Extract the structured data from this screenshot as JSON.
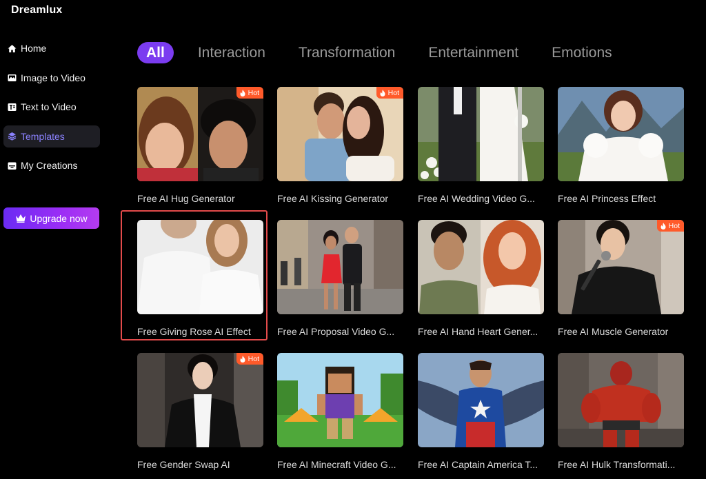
{
  "app": {
    "name": "Dreamlux"
  },
  "sidebar": {
    "items": [
      {
        "label": "Home",
        "icon": "home-icon"
      },
      {
        "label": "Image to Video",
        "icon": "image-icon"
      },
      {
        "label": "Text to Video",
        "icon": "text-icon"
      },
      {
        "label": "Templates",
        "icon": "layers-icon",
        "active": true
      },
      {
        "label": "My Creations",
        "icon": "folder-icon"
      }
    ],
    "upgrade_label": "Upgrade now"
  },
  "tabs": [
    {
      "label": "All",
      "active": true
    },
    {
      "label": "Interaction"
    },
    {
      "label": "Transformation"
    },
    {
      "label": "Entertainment"
    },
    {
      "label": "Emotions"
    }
  ],
  "hot_label": "Hot",
  "cards": [
    {
      "title": "Free AI Hug Generator",
      "hot": true
    },
    {
      "title": "Free AI Kissing Generator",
      "hot": true
    },
    {
      "title": "Free AI Wedding Video G...",
      "hot": false
    },
    {
      "title": "Free AI Princess Effect",
      "hot": false
    },
    {
      "title": "Free Giving Rose AI Effect",
      "hot": false,
      "selected": true
    },
    {
      "title": "Free AI Proposal Video G...",
      "hot": false
    },
    {
      "title": "Free AI Hand Heart Gener...",
      "hot": false
    },
    {
      "title": "Free AI Muscle Generator",
      "hot": true
    },
    {
      "title": "Free Gender Swap AI",
      "hot": true
    },
    {
      "title": "Free AI Minecraft Video G...",
      "hot": false
    },
    {
      "title": "Free AI Captain America T...",
      "hot": false
    },
    {
      "title": "Free AI Hulk Transformati...",
      "hot": false
    }
  ],
  "colors": {
    "accent": "#7b3cf0",
    "hot": "#ff5a2a",
    "selection": "#e34b4b",
    "active_nav_text": "#8b82ff"
  }
}
